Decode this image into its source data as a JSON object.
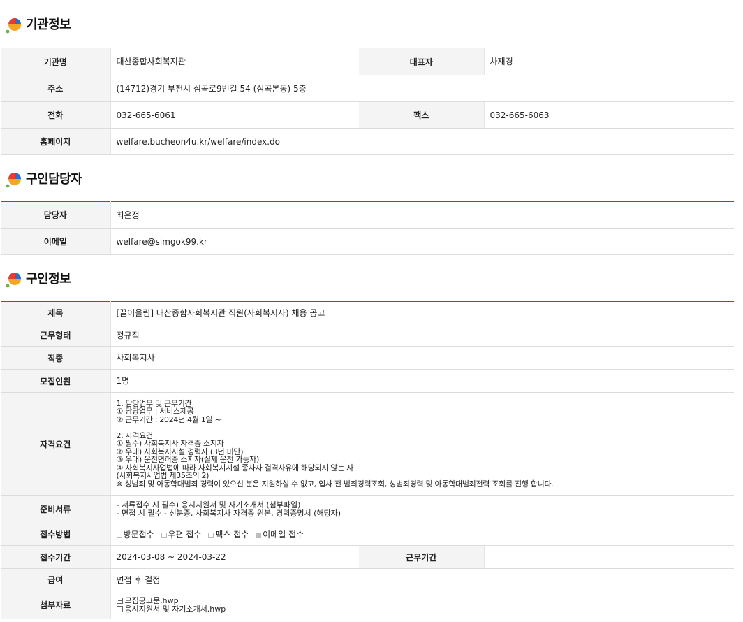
{
  "sections": {
    "agency": {
      "title": "기관정보",
      "rows": {
        "name_label": "기관명",
        "name_value": "대산종합사회복지관",
        "rep_label": "대표자",
        "rep_value": "차재경",
        "addr_label": "주소",
        "addr_value": "(14712)경기 부천시 심곡로9번길 54 (심곡본동) 5층",
        "tel_label": "전화",
        "tel_value": "032-665-6061",
        "fax_label": "팩스",
        "fax_value": "032-665-6063",
        "home_label": "홈페이지",
        "home_value": "welfare.bucheon4u.kr/welfare/index.do"
      }
    },
    "contact": {
      "title": "구인담당자",
      "rows": {
        "person_label": "담당자",
        "person_value": "최은정",
        "email_label": "이메일",
        "email_value": "welfare@simgok99.kr"
      }
    },
    "job": {
      "title": "구인정보",
      "rows": {
        "subject_label": "제목",
        "subject_value": "[끌어올림] 대산종합사회복지관 직원(사회복지사) 채용 공고",
        "type_label": "근무형태",
        "type_value": "정규직",
        "kind_label": "직종",
        "kind_value": "사회복지사",
        "count_label": "모집인원",
        "count_value": "1명",
        "qual_label": "자격요건",
        "qual_value": "1. 담당업무 및 근무기간\n ① 담당업무 : 서비스제공\n ② 근무기간 : 2024년 4월 1일 ~\n\n2. 자격요건\n ① 필수) 사회복지사 자격증 소지자\n ② 우대) 사회복지시설 경력자 (3년 미만)\n ③ 우대) 운전면허증 소지자(실제 운전 가능자)\n ④ 사회복지사업법에 따라 사회복지시설 종사자 결격사유에 해당되지 않는 자\n   (사회복지사업법 제35조의 2)\n ※ 성범죄 및 아동학대범죄 경력이 있으신 분은 지원하실 수 없고, 입사 전 범죄경력조회, 성범죄경력 및 아동학대범죄전력 조회를 진행 합니다.",
        "docs_label": "준비서류",
        "docs_value": " - 서류접수 시 필수)  응시지원서 및 자기소개서 (첨부파일)\n - 면접 시 필수 - 신분증, 사회복지사 자격증 원본, 경력증명서 (해당자)",
        "method_label": "접수방법",
        "methods": [
          "방문접수",
          "우편 접수",
          "팩스 접수",
          "이메일 접수"
        ],
        "period_label": "접수기간",
        "period_value": "2024-03-08 ~ 2024-03-22",
        "workperiod_label": "근무기간",
        "workperiod_value": "",
        "pay_label": "급여",
        "pay_value": "면접 후 결정",
        "files_label": "첨부자료",
        "files": [
          "모집공고문.hwp",
          "응시지원서 및 자기소개서.hwp"
        ]
      }
    }
  }
}
